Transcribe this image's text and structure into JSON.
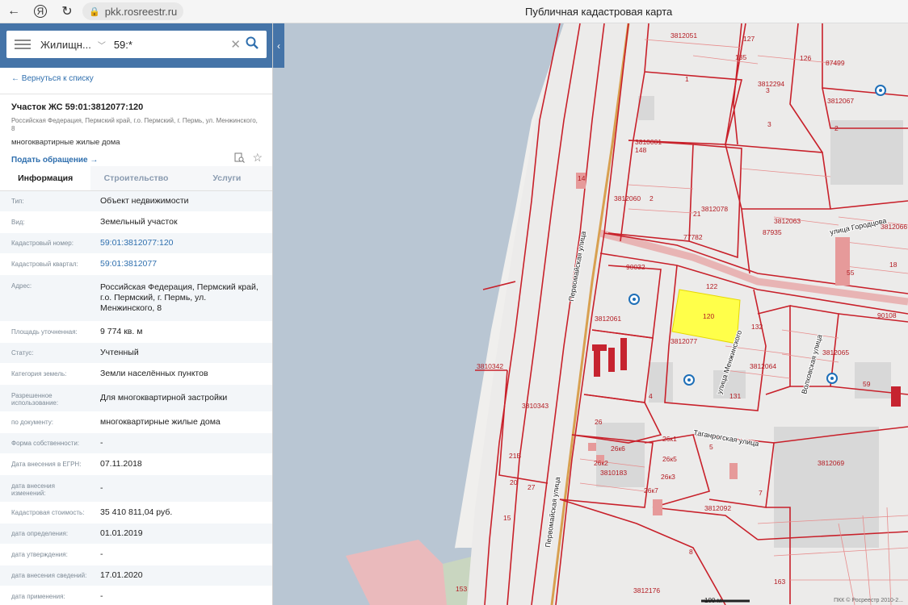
{
  "browser": {
    "url": "pkk.rosreestr.ru",
    "title": "Публичная кадастровая карта",
    "reload_icon": "reload-icon"
  },
  "search": {
    "type": "Жилищн...",
    "query": "59:*"
  },
  "sidebar": {
    "back_link": "← Вернуться к списку",
    "title": "Участок ЖС 59:01:3812077:120",
    "address_small": "Российская Федерация, Пермский край, г.о. Пермский, г. Пермь, ул. Менжинского, 8",
    "use": "многоквартирные жилые дома",
    "appeal_link": "Подать обращение →",
    "tabs": [
      {
        "label": "Информация",
        "active": true
      },
      {
        "label": "Строительство",
        "active": false
      },
      {
        "label": "Услуги",
        "active": false
      }
    ],
    "rows": [
      {
        "key": "Тип:",
        "value": "Объект недвижимости"
      },
      {
        "key": "Вид:",
        "value": "Земельный участок"
      },
      {
        "key": "Кадастровый номер:",
        "value": "59:01:3812077:120",
        "link": true
      },
      {
        "key": "Кадастровый квартал:",
        "value": "59:01:3812077",
        "link": true
      },
      {
        "key": "Адрес:",
        "value": "Российская Федерация, Пермский край, г.о. Пермский, г. Пермь, ул. Менжинского, 8"
      },
      {
        "key": "Площадь уточненная:",
        "value": "9 774 кв. м"
      },
      {
        "key": "Статус:",
        "value": "Учтенный"
      },
      {
        "key": "Категория земель:",
        "value": "Земли населённых пунктов"
      },
      {
        "key": "Разрешенное использование:",
        "value": "Для многоквартирной застройки"
      },
      {
        "key": "по документу:",
        "value": "многоквартирные жилые дома"
      },
      {
        "key": "Форма собственности:",
        "value": "-"
      },
      {
        "key": "Дата внесения в ЕГРН:",
        "value": "07.11.2018"
      },
      {
        "key": "дата внесения изменений:",
        "value": "-"
      },
      {
        "key": "Кадастровая стоимость:",
        "value": "35 410 811,04 руб."
      },
      {
        "key": "дата определения:",
        "value": "01.01.2019"
      },
      {
        "key": "дата утверждения:",
        "value": "-"
      },
      {
        "key": "дата внесения сведений:",
        "value": "17.01.2020"
      },
      {
        "key": "дата применения:",
        "value": "-"
      }
    ]
  },
  "map": {
    "labels": [
      {
        "t": "3812051"
      },
      {
        "t": "127"
      },
      {
        "t": "135"
      },
      {
        "t": "126"
      },
      {
        "t": "3812294"
      },
      {
        "t": "87499"
      },
      {
        "t": "3812067"
      },
      {
        "t": "1"
      },
      {
        "t": "3"
      },
      {
        "t": "3"
      },
      {
        "t": "2"
      },
      {
        "t": "3810001"
      },
      {
        "t": "148"
      },
      {
        "t": "3812060"
      },
      {
        "t": "2"
      },
      {
        "t": "3812078"
      },
      {
        "t": "21"
      },
      {
        "t": "3812063"
      },
      {
        "t": "87935"
      },
      {
        "t": "77782"
      },
      {
        "t": "90032"
      },
      {
        "t": "122"
      },
      {
        "t": "120"
      },
      {
        "t": "3812061"
      },
      {
        "t": "3812077"
      },
      {
        "t": "3812064"
      },
      {
        "t": "132"
      },
      {
        "t": "131"
      },
      {
        "t": "3812065"
      },
      {
        "t": "59"
      },
      {
        "t": "3810342"
      },
      {
        "t": "3810343"
      },
      {
        "t": "26"
      },
      {
        "t": "26к6"
      },
      {
        "t": "26к1"
      },
      {
        "t": "26к5"
      },
      {
        "t": "26к2"
      },
      {
        "t": "3810183"
      },
      {
        "t": "26к3"
      },
      {
        "t": "26к7"
      },
      {
        "t": "3812092"
      },
      {
        "t": "3812069"
      },
      {
        "t": "3812176"
      },
      {
        "t": "163"
      },
      {
        "t": "153"
      },
      {
        "t": "18"
      },
      {
        "t": "55"
      },
      {
        "t": "90108"
      },
      {
        "t": "3812066"
      },
      {
        "t": "4"
      },
      {
        "t": "5"
      },
      {
        "t": "7"
      },
      {
        "t": "8"
      },
      {
        "t": "27"
      },
      {
        "t": "15"
      },
      {
        "t": "20"
      },
      {
        "t": "21Б"
      },
      {
        "t": "14"
      }
    ],
    "street_labels": [
      {
        "t": "Первомайская улица"
      },
      {
        "t": "Первомайская улица"
      },
      {
        "t": "улица Менжинского"
      },
      {
        "t": "Таганрогская улица"
      },
      {
        "t": "Волховская улица"
      },
      {
        "t": "улица Городцова"
      }
    ],
    "scale_text": "100 м",
    "copyright": "ПКК © Росреестр 2010-2..."
  }
}
